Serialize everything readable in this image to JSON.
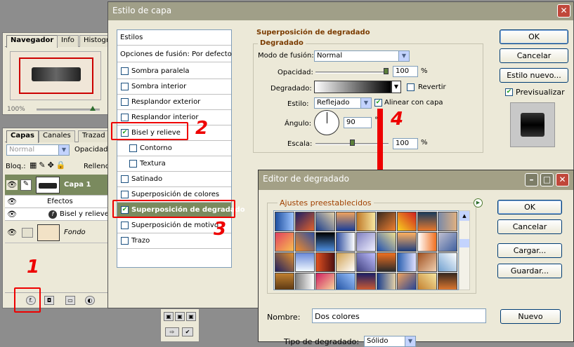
{
  "navigator": {
    "tabs": [
      "Navegador",
      "Info",
      "Histogr"
    ],
    "zoom": "100%"
  },
  "layers": {
    "tabs": [
      "Capas",
      "Canales",
      "Trazad"
    ],
    "blend_mode": "Normal",
    "opacity_label": "Opacidad:",
    "lock_label": "Bloq.:",
    "fill_label": "Relleno:",
    "layer1_name": "Capa 1",
    "effects_label": "Efectos",
    "bevel_label": "Bisel y relieve",
    "background_name": "Fondo"
  },
  "layer_style": {
    "title": "Estilo de capa",
    "list_header": "Estilos",
    "blend_options": "Opciones de fusión: Por defecto",
    "items": [
      {
        "label": "Sombra paralela",
        "checked": false
      },
      {
        "label": "Sombra interior",
        "checked": false
      },
      {
        "label": "Resplandor exterior",
        "checked": false
      },
      {
        "label": "Resplandor interior",
        "checked": false
      },
      {
        "label": "Bisel y relieve",
        "checked": true
      },
      {
        "label": "Contorno",
        "checked": false
      },
      {
        "label": "Textura",
        "checked": false
      },
      {
        "label": "Satinado",
        "checked": false
      },
      {
        "label": "Superposición de colores",
        "checked": false
      },
      {
        "label": "Superposición de degradado",
        "checked": true
      },
      {
        "label": "Superposición de motivo",
        "checked": false
      },
      {
        "label": "Trazo",
        "checked": false
      }
    ],
    "section_title": "Superposición de degradado",
    "group_title": "Degradado",
    "blend_label": "Modo de fusión:",
    "blend_value": "Normal",
    "opacity_label": "Opacidad:",
    "opacity_value": "100",
    "opacity_unit": "%",
    "opacity_level": 1.0,
    "gradient_label": "Degradado:",
    "reverse_label": "Revertir",
    "style_label": "Estilo:",
    "style_value": "Reflejado",
    "align_label": "Alinear con capa",
    "angle_label": "Ángulo:",
    "angle_value": "90",
    "angle_unit": "°",
    "scale_label": "Escala:",
    "scale_value": "100",
    "scale_unit": "%",
    "scale_level": 0.5,
    "ok_label": "OK",
    "cancel_label": "Cancelar",
    "new_style_label": "Estilo nuevo...",
    "preview_label": "Previsualizar"
  },
  "gradient_editor": {
    "title": "Editor de degradado",
    "presets_title": "Ajustes preestablecidos",
    "ok_label": "OK",
    "cancel_label": "Cancelar",
    "load_label": "Cargar...",
    "save_label": "Guardar...",
    "name_label": "Nombre:",
    "name_value": "Dos colores",
    "new_label": "Nuevo",
    "type_label": "Tipo de degradado:",
    "type_value": "Sólido"
  },
  "annotations": [
    "1",
    "2",
    "3",
    "4"
  ],
  "colors": {
    "accent_red": "#e00000",
    "xp_titlebar": "#a09f88",
    "dialog_bg": "#ece9d8",
    "selected_item": "#7a8a5e"
  }
}
